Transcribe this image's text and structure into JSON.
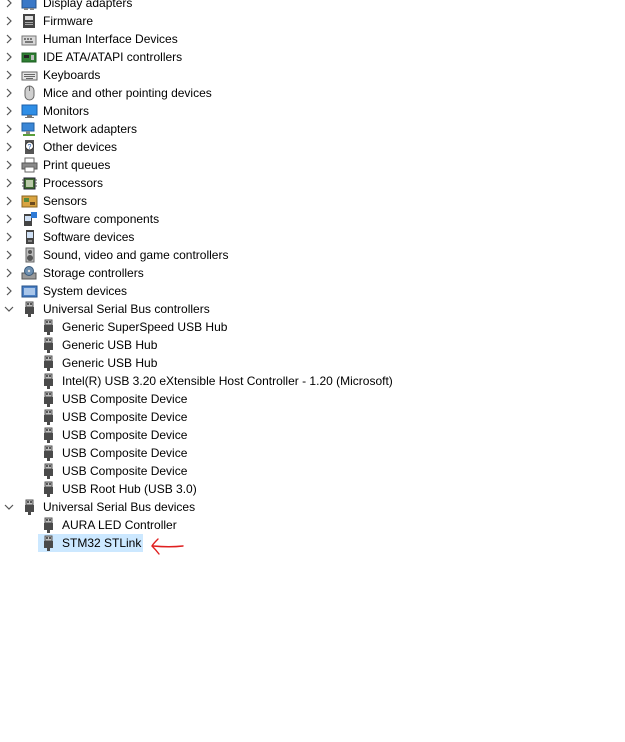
{
  "tree": {
    "categories": [
      {
        "label": "Display adapters",
        "icon": "display-adapter-icon",
        "expanded": false
      },
      {
        "label": "Firmware",
        "icon": "firmware-icon",
        "expanded": false
      },
      {
        "label": "Human Interface Devices",
        "icon": "hid-icon",
        "expanded": false
      },
      {
        "label": "IDE ATA/ATAPI controllers",
        "icon": "ide-controller-icon",
        "expanded": false
      },
      {
        "label": "Keyboards",
        "icon": "keyboard-icon",
        "expanded": false
      },
      {
        "label": "Mice and other pointing devices",
        "icon": "mouse-icon",
        "expanded": false
      },
      {
        "label": "Monitors",
        "icon": "monitor-icon",
        "expanded": false
      },
      {
        "label": "Network adapters",
        "icon": "network-adapter-icon",
        "expanded": false
      },
      {
        "label": "Other devices",
        "icon": "unknown-device-icon",
        "expanded": false
      },
      {
        "label": "Print queues",
        "icon": "printer-icon",
        "expanded": false
      },
      {
        "label": "Processors",
        "icon": "processor-icon",
        "expanded": false
      },
      {
        "label": "Sensors",
        "icon": "sensor-icon",
        "expanded": false
      },
      {
        "label": "Software components",
        "icon": "software-component-icon",
        "expanded": false
      },
      {
        "label": "Software devices",
        "icon": "software-device-icon",
        "expanded": false
      },
      {
        "label": "Sound, video and game controllers",
        "icon": "speaker-icon",
        "expanded": false
      },
      {
        "label": "Storage controllers",
        "icon": "storage-controller-icon",
        "expanded": false
      },
      {
        "label": "System devices",
        "icon": "system-device-icon",
        "expanded": false
      },
      {
        "label": "Universal Serial Bus controllers",
        "icon": "usb-plug-icon",
        "expanded": true,
        "children": [
          "Generic SuperSpeed USB Hub",
          "Generic USB Hub",
          "Generic USB Hub",
          "Intel(R) USB 3.20 eXtensible Host Controller - 1.20 (Microsoft)",
          "USB Composite Device",
          "USB Composite Device",
          "USB Composite Device",
          "USB Composite Device",
          "USB Composite Device",
          "USB Root Hub (USB 3.0)"
        ]
      },
      {
        "label": "Universal Serial Bus devices",
        "icon": "usb-plug-icon",
        "expanded": true,
        "children": [
          "AURA LED Controller",
          "STM32 STLink"
        ]
      }
    ],
    "selected": "STM32 STLink"
  },
  "colors": {
    "selection": "#cce8ff",
    "annotation_arrow": "#e02020"
  },
  "annotation": {
    "type": "hand-drawn-arrow",
    "points_to": "STM32 STLink"
  }
}
